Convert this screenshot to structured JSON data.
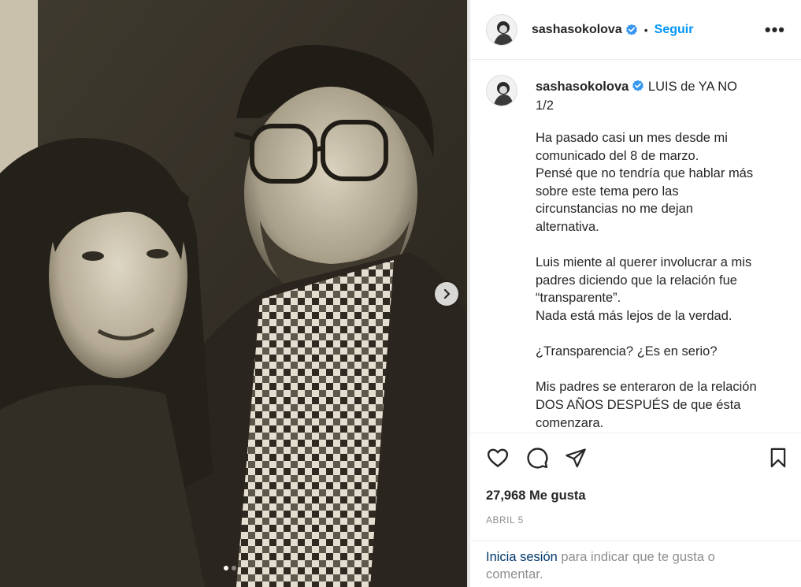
{
  "post": {
    "photo_alt": "Fotografía en blanco y negro",
    "carousel": {
      "total": 2,
      "current": 1
    }
  },
  "header": {
    "username": "sashasokolova",
    "separator": "•",
    "follow_label": "Seguir",
    "more_label": "•••"
  },
  "caption": {
    "username": "sashasokolova",
    "title": "LUIS de YA NO",
    "subtitle": "1/2",
    "paragraphs": [
      [
        "Ha pasado casi un mes desde mi",
        "comunicado del 8 de marzo.",
        "Pensé que no tendría que hablar más",
        "sobre este tema pero las",
        "circunstancias no me dejan",
        "alternativa."
      ],
      [
        "Luis miente al querer involucrar a mis",
        "padres diciendo que la relación fue",
        "“transparente”.",
        "Nada está más lejos de la verdad."
      ],
      [
        "¿Transparencia? ¿Es en serio?"
      ],
      [
        "Mis padres se enteraron de la relación",
        "DOS AÑOS DESPUÉS de que ésta",
        "comenzara."
      ]
    ]
  },
  "stats": {
    "likes": "27,968 Me gusta",
    "date": "ABRIL 5"
  },
  "login_prompt": {
    "link": "Inicia sesión",
    "text": " para indicar que te gusta o comentar."
  },
  "colors": {
    "accent": "#0095f6",
    "verified": "#3897f0",
    "link": "#00376b",
    "muted": "#8e8e8e"
  }
}
